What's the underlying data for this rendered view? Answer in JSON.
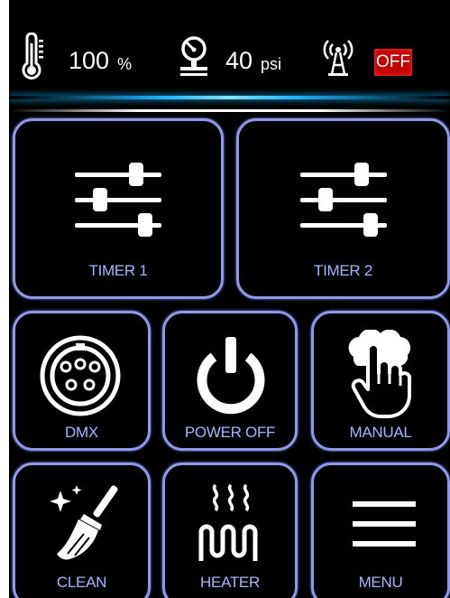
{
  "status": {
    "humidity": {
      "value": "100",
      "unit": "%",
      "icon": "thermometer-icon"
    },
    "pressure": {
      "value": "40",
      "unit": "psi",
      "icon": "pressure-gauge-icon"
    },
    "wireless": {
      "icon": "antenna-icon",
      "state": "OFF",
      "state_color": "#c40000"
    }
  },
  "tiles": {
    "timer1": {
      "label": "TIMER 1",
      "icon": "sliders-icon"
    },
    "timer2": {
      "label": "TIMER 2",
      "icon": "sliders-icon"
    },
    "dmx": {
      "label": "DMX",
      "icon": "dmx-connector-icon"
    },
    "power": {
      "label": "POWER OFF",
      "icon": "power-icon"
    },
    "manual": {
      "label": "MANUAL",
      "icon": "hand-press-icon"
    },
    "clean": {
      "label": "CLEAN",
      "icon": "broom-sparkle-icon"
    },
    "heater": {
      "label": "HEATER",
      "icon": "heater-coil-icon"
    },
    "menu": {
      "label": "MENU",
      "icon": "hamburger-menu-icon"
    }
  },
  "colors": {
    "tile_border": "#8f99e8",
    "label": "#a9b4ff",
    "glow": "#1ab6ff"
  }
}
